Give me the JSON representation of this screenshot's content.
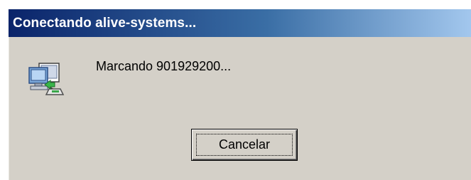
{
  "window": {
    "title": "Conectando alive-systems..."
  },
  "content": {
    "icon": "dial-up-network-connection-icon",
    "message": "Marcando 901929200..."
  },
  "buttons": {
    "cancel_label": "Cancelar"
  },
  "colors": {
    "titlebar_start": "#0a246a",
    "titlebar_end": "#a6caf0",
    "dialog_background": "#d4d0c8"
  }
}
